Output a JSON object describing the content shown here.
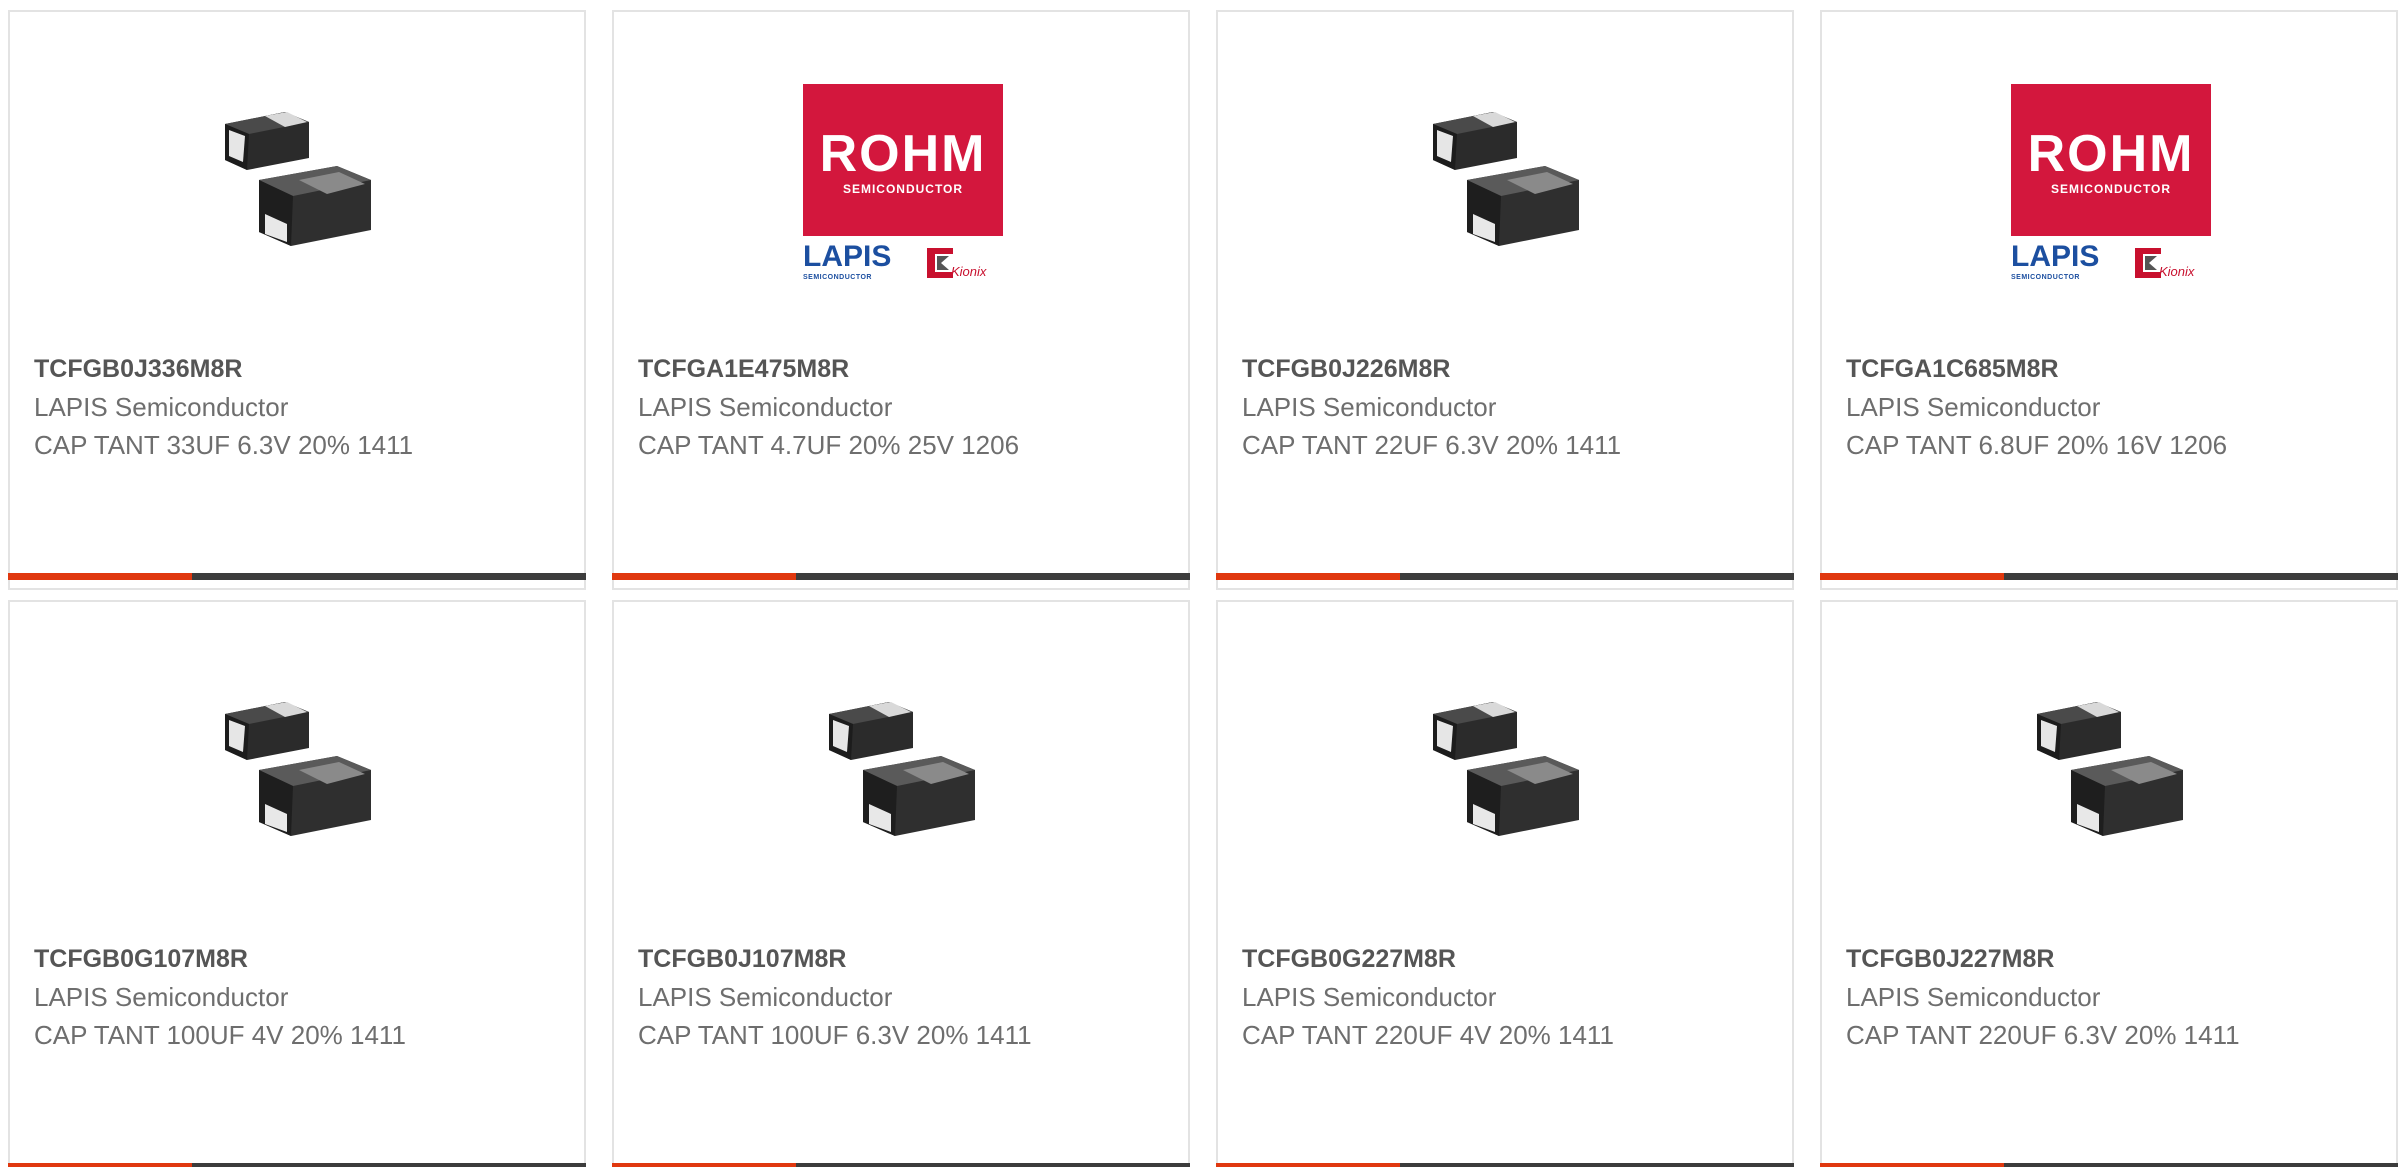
{
  "products": [
    {
      "part": "TCFGB0J336M8R",
      "maker": "LAPIS Semiconductor",
      "desc": "CAP TANT 33UF 6.3V 20% 1411",
      "image": "capacitor-chip-icon"
    },
    {
      "part": "TCFGA1E475M8R",
      "maker": "LAPIS Semiconductor",
      "desc": "CAP TANT 4.7UF 20% 25V 1206",
      "image": "rohm-logo"
    },
    {
      "part": "TCFGB0J226M8R",
      "maker": "LAPIS Semiconductor",
      "desc": "CAP TANT 22UF 6.3V 20% 1411",
      "image": "capacitor-chip-icon"
    },
    {
      "part": "TCFGA1C685M8R",
      "maker": "LAPIS Semiconductor",
      "desc": "CAP TANT 6.8UF 20% 16V 1206",
      "image": "rohm-logo"
    },
    {
      "part": "TCFGB0G107M8R",
      "maker": "LAPIS Semiconductor",
      "desc": "CAP TANT 100UF 4V 20% 1411",
      "image": "capacitor-chip-icon"
    },
    {
      "part": "TCFGB0J107M8R",
      "maker": "LAPIS Semiconductor",
      "desc": "CAP TANT 100UF 6.3V 20% 1411",
      "image": "capacitor-chip-icon"
    },
    {
      "part": "TCFGB0G227M8R",
      "maker": "LAPIS Semiconductor",
      "desc": "CAP TANT 220UF 4V 20% 1411",
      "image": "capacitor-chip-icon"
    },
    {
      "part": "TCFGB0J227M8R",
      "maker": "LAPIS Semiconductor",
      "desc": "CAP TANT 220UF 6.3V 20% 1411",
      "image": "capacitor-chip-icon"
    }
  ],
  "logo": {
    "brand": "ROHM",
    "brand_sub": "SEMICONDUCTOR",
    "lapis": "LAPIS",
    "lapis_sub": "SEMICONDUCTOR",
    "kionix": "Kionix"
  },
  "colors": {
    "accent": "#e0380f",
    "bar": "#3c3c3c",
    "rohm_red": "#d3173d",
    "lapis_blue": "#1c4fa0"
  }
}
